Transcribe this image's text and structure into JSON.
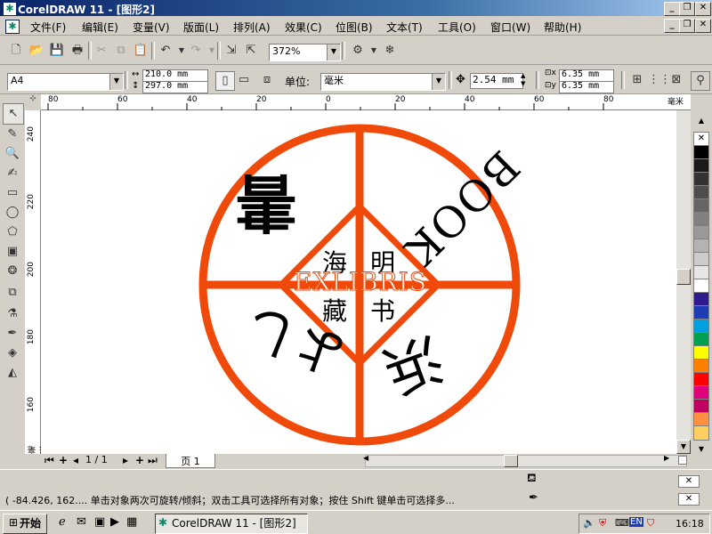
{
  "window": {
    "title": "CorelDRAW 11 - [图形2]"
  },
  "menu": [
    "文件(F)",
    "编辑(E)",
    "变量(V)",
    "版面(L)",
    "排列(A)",
    "效果(C)",
    "位图(B)",
    "文本(T)",
    "工具(O)",
    "窗口(W)",
    "帮助(H)"
  ],
  "toolbar": {
    "zoom": "372%"
  },
  "property_bar": {
    "page_size": "A4",
    "width": "210.0 mm",
    "height": "297.0 mm",
    "unit_label": "单位:",
    "unit": "毫米",
    "nudge": "2.54 mm",
    "dup_x": "6.35 mm",
    "dup_y": "6.35 mm"
  },
  "ruler": {
    "unit": "毫米",
    "h_ticks": [
      "80",
      "60",
      "40",
      "20",
      "0",
      "20",
      "40",
      "60",
      "80"
    ],
    "v_ticks": [
      "240",
      "220",
      "200",
      "180",
      "160"
    ]
  },
  "artwork": {
    "color": "#f04a0a",
    "text_book": "BOOK",
    "text_center_1": "海",
    "text_center_2": "明",
    "text_center_3": "藏",
    "text_center_4": "书",
    "text_exlibris": "EXLIBRIS",
    "text_upper_left": "書",
    "text_lower_left": "よし",
    "text_lower_right": "浜"
  },
  "page_nav": {
    "counter": "1 / 1",
    "tab": "页 1"
  },
  "status": {
    "text": "( -84.426, 162....  单击对象两次可旋转/倾斜；双击工具可选择所有对象；按住 Shift 键单击可选择多..."
  },
  "taskbar": {
    "start": "开始",
    "task": "CorelDRAW 11 - [图形2]",
    "lang": "EN",
    "clock": "16:18"
  },
  "palette": [
    "#ffffff",
    "#000000",
    "#1a1a1a",
    "#333333",
    "#4d4d4d",
    "#666666",
    "#808080",
    "#999999",
    "#b3b3b3",
    "#cccccc",
    "#e6e6e6",
    "#ffffff",
    "#2e1a8a",
    "#1e3cb4",
    "#00a0e0",
    "#00a050",
    "#ffff00",
    "#ff8000",
    "#ff0000",
    "#e0007a",
    "#c00060",
    "#ff9040",
    "#ffd060"
  ]
}
